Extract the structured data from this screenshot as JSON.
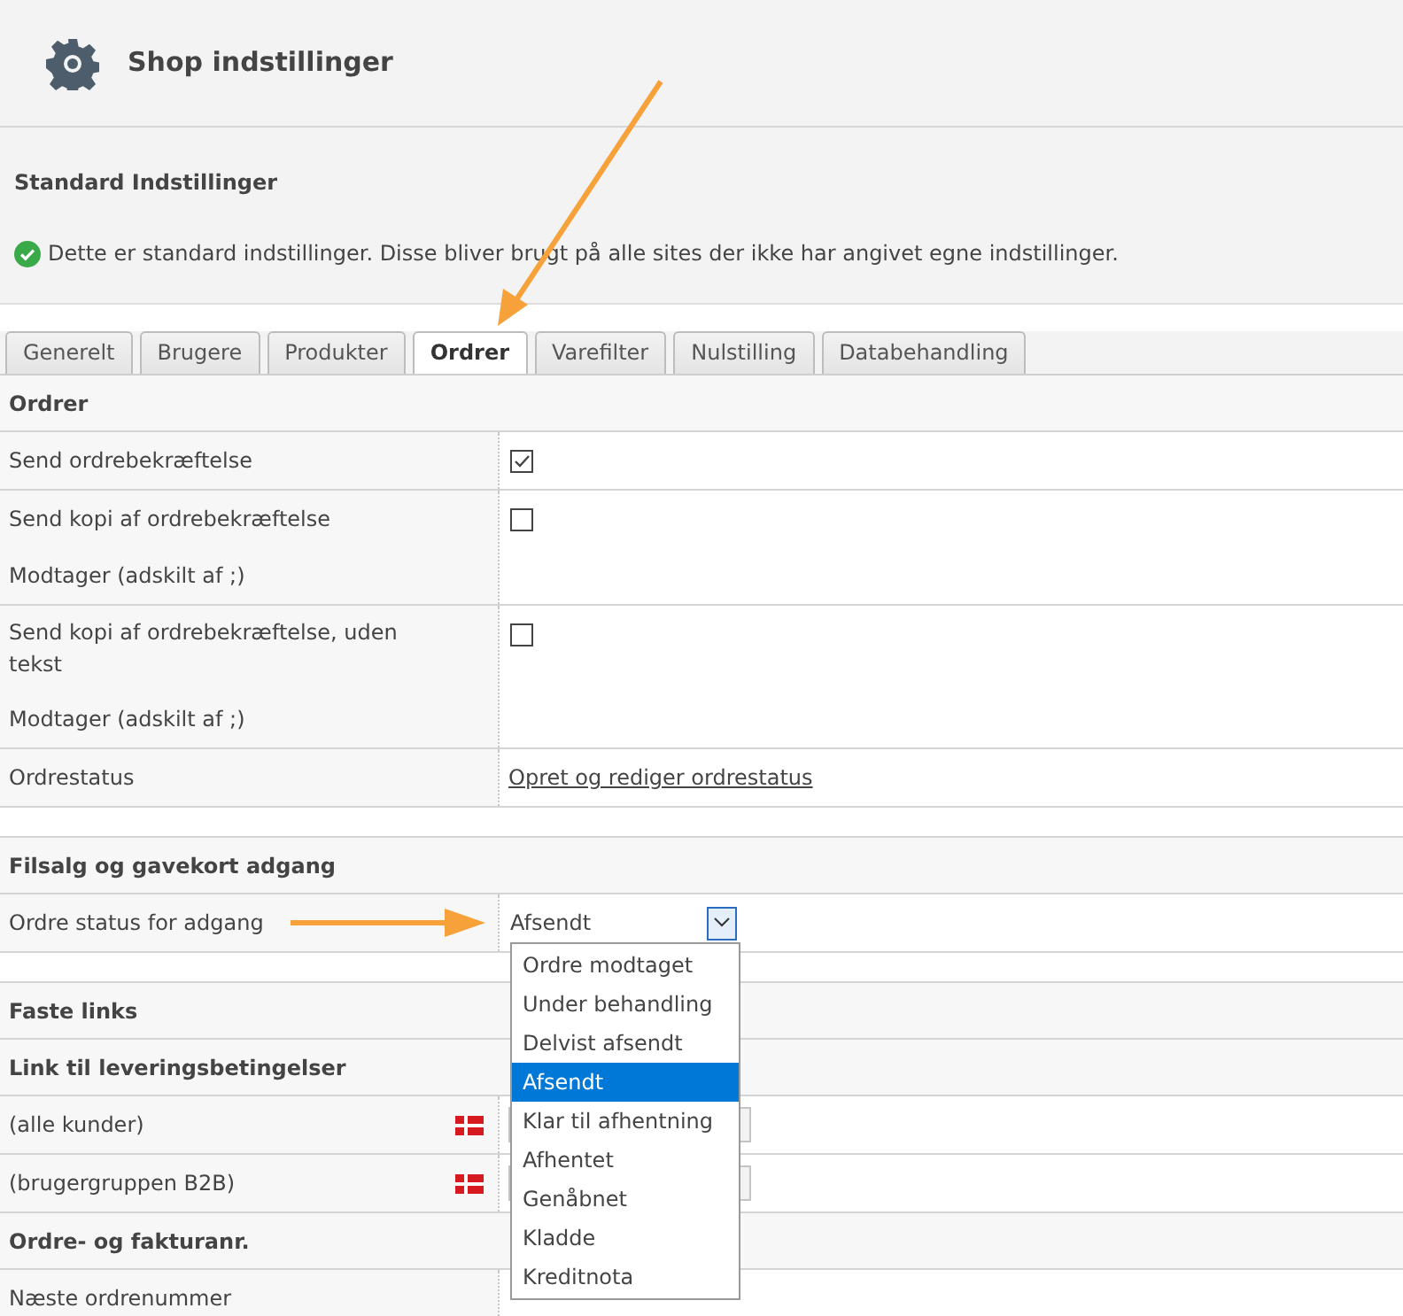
{
  "title": "Shop indstillinger",
  "panel": {
    "heading": "Standard Indstillinger",
    "message": "Dette er standard indstillinger. Disse bliver brugt på alle sites der ikke har angivet egne indstillinger."
  },
  "tabs": [
    {
      "label": "Generelt",
      "selected": false
    },
    {
      "label": "Brugere",
      "selected": false
    },
    {
      "label": "Produkter",
      "selected": false
    },
    {
      "label": "Ordrer",
      "selected": true
    },
    {
      "label": "Varefilter",
      "selected": false
    },
    {
      "label": "Nulstilling",
      "selected": false
    },
    {
      "label": "Databehandling",
      "selected": false
    }
  ],
  "groups": [
    {
      "rows": [
        {
          "kind": "header",
          "label": "Ordrer"
        },
        {
          "kind": "checkbox",
          "label": "Send ordrebekræftelse",
          "checked": true
        },
        {
          "kind": "checkbox",
          "label": "Send kopi af ordrebekræftelse",
          "checked": false,
          "recipient": {
            "label": "Modtager (adskilt af ;)"
          }
        },
        {
          "kind": "checkbox",
          "label": "Send kopi af ordrebekræftelse, uden tekst",
          "checked": false,
          "recipient": {
            "label": "Modtager (adskilt af ;)"
          }
        },
        {
          "kind": "link",
          "label": "Ordrestatus",
          "link": "Opret og rediger ordrestatus"
        }
      ]
    },
    {
      "rows": [
        {
          "kind": "header",
          "label": "Filsalg og gavekort adgang"
        },
        {
          "kind": "select",
          "label": "Ordre status for adgang",
          "value": "Afsendt",
          "expanded": true,
          "options": [
            {
              "label": "Ordre modtaget",
              "selected": false
            },
            {
              "label": "Under behandling",
              "selected": false
            },
            {
              "label": "Delvist afsendt",
              "selected": false
            },
            {
              "label": "Afsendt",
              "selected": true
            },
            {
              "label": "Klar til afhentning",
              "selected": false
            },
            {
              "label": "Afhentet",
              "selected": false
            },
            {
              "label": "Genåbnet",
              "selected": false
            },
            {
              "label": "Kladde",
              "selected": false
            },
            {
              "label": "Kreditnota",
              "selected": false
            }
          ]
        }
      ]
    },
    {
      "rows": [
        {
          "kind": "header",
          "label": "Faste links"
        },
        {
          "kind": "header",
          "label": "Link til leveringsbetingelser"
        },
        {
          "kind": "flag_select",
          "label": "(alle kunder)"
        },
        {
          "kind": "flag_select",
          "label": "(brugergruppen B2B)"
        },
        {
          "kind": "header",
          "label": "Ordre- og fakturanr."
        },
        {
          "kind": "plain",
          "label": "Næste ordrenummer"
        }
      ]
    }
  ]
}
